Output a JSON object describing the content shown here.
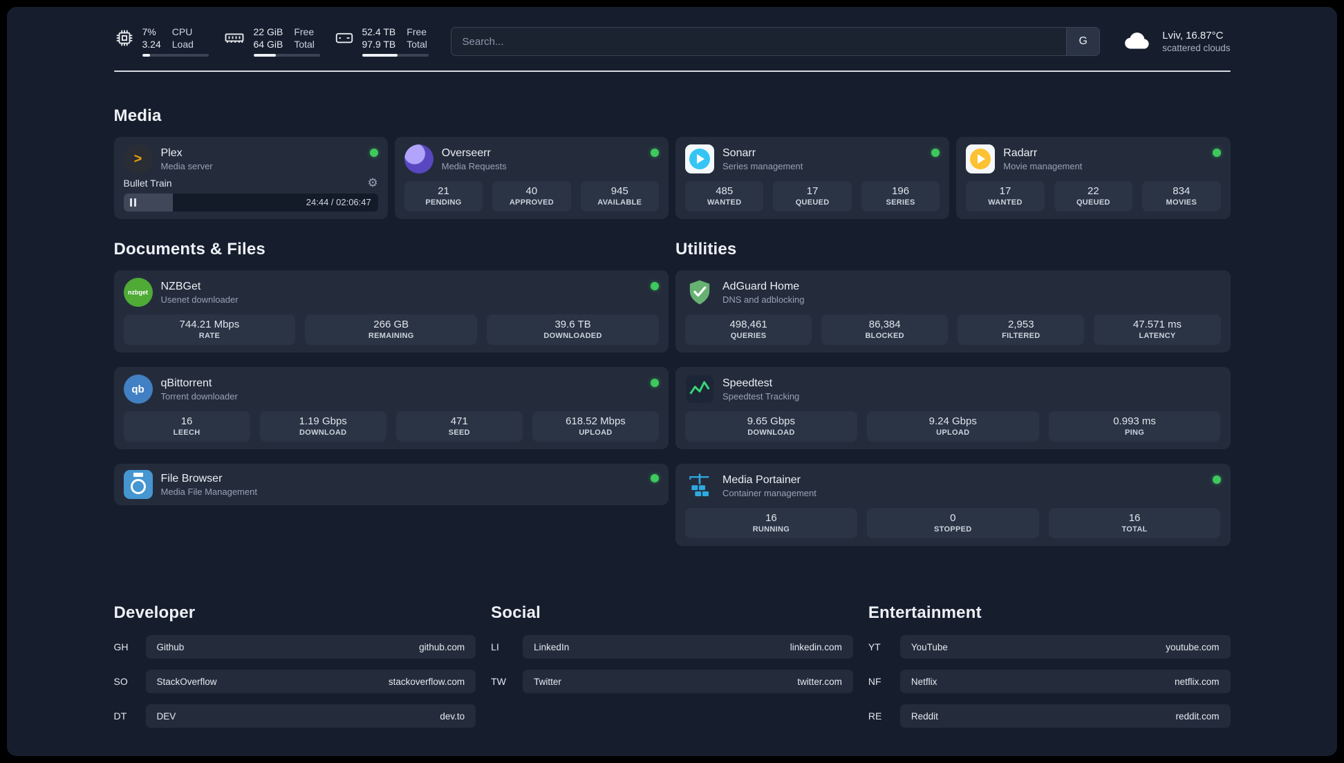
{
  "colors": {
    "status_online": "#3ec95d",
    "plex_amber": "#e5a00d",
    "sonarr_blue": "#35c5f4",
    "radarr_yellow": "#fdc231",
    "adguard_green": "#67b173",
    "portainer_blue": "#2fa8e0",
    "page_background": "#161e2d",
    "card_background": "#242c3c"
  },
  "icons": {
    "plex_glyph": ">",
    "gear_glyph": "⚙",
    "nzbget_text": "nzbget",
    "qbittorrent_text": "qb"
  },
  "topbar": {
    "cpu": {
      "line1": "7%",
      "line2": "3.24",
      "label1": "CPU",
      "label2": "Load",
      "progress": 12
    },
    "ram": {
      "line1": "22 GiB",
      "line2": "64 GiB",
      "label1": "Free",
      "label2": "Total",
      "progress": 34
    },
    "disk": {
      "line1": "52.4 TB",
      "line2": "97.9 TB",
      "label1": "Free",
      "label2": "Total",
      "progress": 54
    },
    "search": {
      "placeholder": "Search...",
      "engine_label": "G"
    },
    "weather": {
      "location": "Lviv, 16.87°C",
      "condition": "scattered clouds"
    }
  },
  "media_section": {
    "title": "Media",
    "plex": {
      "name": "Plex",
      "subtitle": "Media server",
      "player": {
        "track": "Bullet Train",
        "time": "24:44 / 02:06:47",
        "progress": 19.5
      }
    },
    "overseerr": {
      "name": "Overseerr",
      "subtitle": "Media Requests",
      "stats": [
        {
          "value": "21",
          "label": "PENDING"
        },
        {
          "value": "40",
          "label": "APPROVED"
        },
        {
          "value": "945",
          "label": "AVAILABLE"
        }
      ]
    },
    "sonarr": {
      "name": "Sonarr",
      "subtitle": "Series management",
      "stats": [
        {
          "value": "485",
          "label": "WANTED"
        },
        {
          "value": "17",
          "label": "QUEUED"
        },
        {
          "value": "196",
          "label": "SERIES"
        }
      ]
    },
    "radarr": {
      "name": "Radarr",
      "subtitle": "Movie management",
      "stats": [
        {
          "value": "17",
          "label": "WANTED"
        },
        {
          "value": "22",
          "label": "QUEUED"
        },
        {
          "value": "834",
          "label": "MOVIES"
        }
      ]
    }
  },
  "documents_section": {
    "title": "Documents & Files",
    "nzbget": {
      "name": "NZBGet",
      "subtitle": "Usenet downloader",
      "stats": [
        {
          "value": "744.21 Mbps",
          "label": "RATE"
        },
        {
          "value": "266 GB",
          "label": "REMAINING"
        },
        {
          "value": "39.6 TB",
          "label": "DOWNLOADED"
        }
      ]
    },
    "qbittorrent": {
      "name": "qBittorrent",
      "subtitle": "Torrent downloader",
      "stats": [
        {
          "value": "16",
          "label": "LEECH"
        },
        {
          "value": "1.19 Gbps",
          "label": "DOWNLOAD"
        },
        {
          "value": "471",
          "label": "SEED"
        },
        {
          "value": "618.52 Mbps",
          "label": "UPLOAD"
        }
      ]
    },
    "filebrowser": {
      "name": "File Browser",
      "subtitle": "Media File Management"
    }
  },
  "utilities_section": {
    "title": "Utilities",
    "adguard": {
      "name": "AdGuard Home",
      "subtitle": "DNS and adblocking",
      "stats": [
        {
          "value": "498,461",
          "label": "QUERIES"
        },
        {
          "value": "86,384",
          "label": "BLOCKED"
        },
        {
          "value": "2,953",
          "label": "FILTERED"
        },
        {
          "value": "47.571 ms",
          "label": "LATENCY"
        }
      ]
    },
    "speedtest": {
      "name": "Speedtest",
      "subtitle": "Speedtest Tracking",
      "stats": [
        {
          "value": "9.65 Gbps",
          "label": "DOWNLOAD"
        },
        {
          "value": "9.24 Gbps",
          "label": "UPLOAD"
        },
        {
          "value": "0.993 ms",
          "label": "PING"
        }
      ]
    },
    "portainer": {
      "name": "Media Portainer",
      "subtitle": "Container management",
      "stats": [
        {
          "value": "16",
          "label": "RUNNING"
        },
        {
          "value": "0",
          "label": "STOPPED"
        },
        {
          "value": "16",
          "label": "TOTAL"
        }
      ]
    }
  },
  "bookmarks": {
    "developer": {
      "title": "Developer",
      "items": [
        {
          "abbr": "GH",
          "name": "Github",
          "url": "github.com"
        },
        {
          "abbr": "SO",
          "name": "StackOverflow",
          "url": "stackoverflow.com"
        },
        {
          "abbr": "DT",
          "name": "DEV",
          "url": "dev.to"
        }
      ]
    },
    "social": {
      "title": "Social",
      "items": [
        {
          "abbr": "LI",
          "name": "LinkedIn",
          "url": "linkedin.com"
        },
        {
          "abbr": "TW",
          "name": "Twitter",
          "url": "twitter.com"
        }
      ]
    },
    "entertainment": {
      "title": "Entertainment",
      "items": [
        {
          "abbr": "YT",
          "name": "YouTube",
          "url": "youtube.com"
        },
        {
          "abbr": "NF",
          "name": "Netflix",
          "url": "netflix.com"
        },
        {
          "abbr": "RE",
          "name": "Reddit",
          "url": "reddit.com"
        }
      ]
    }
  }
}
